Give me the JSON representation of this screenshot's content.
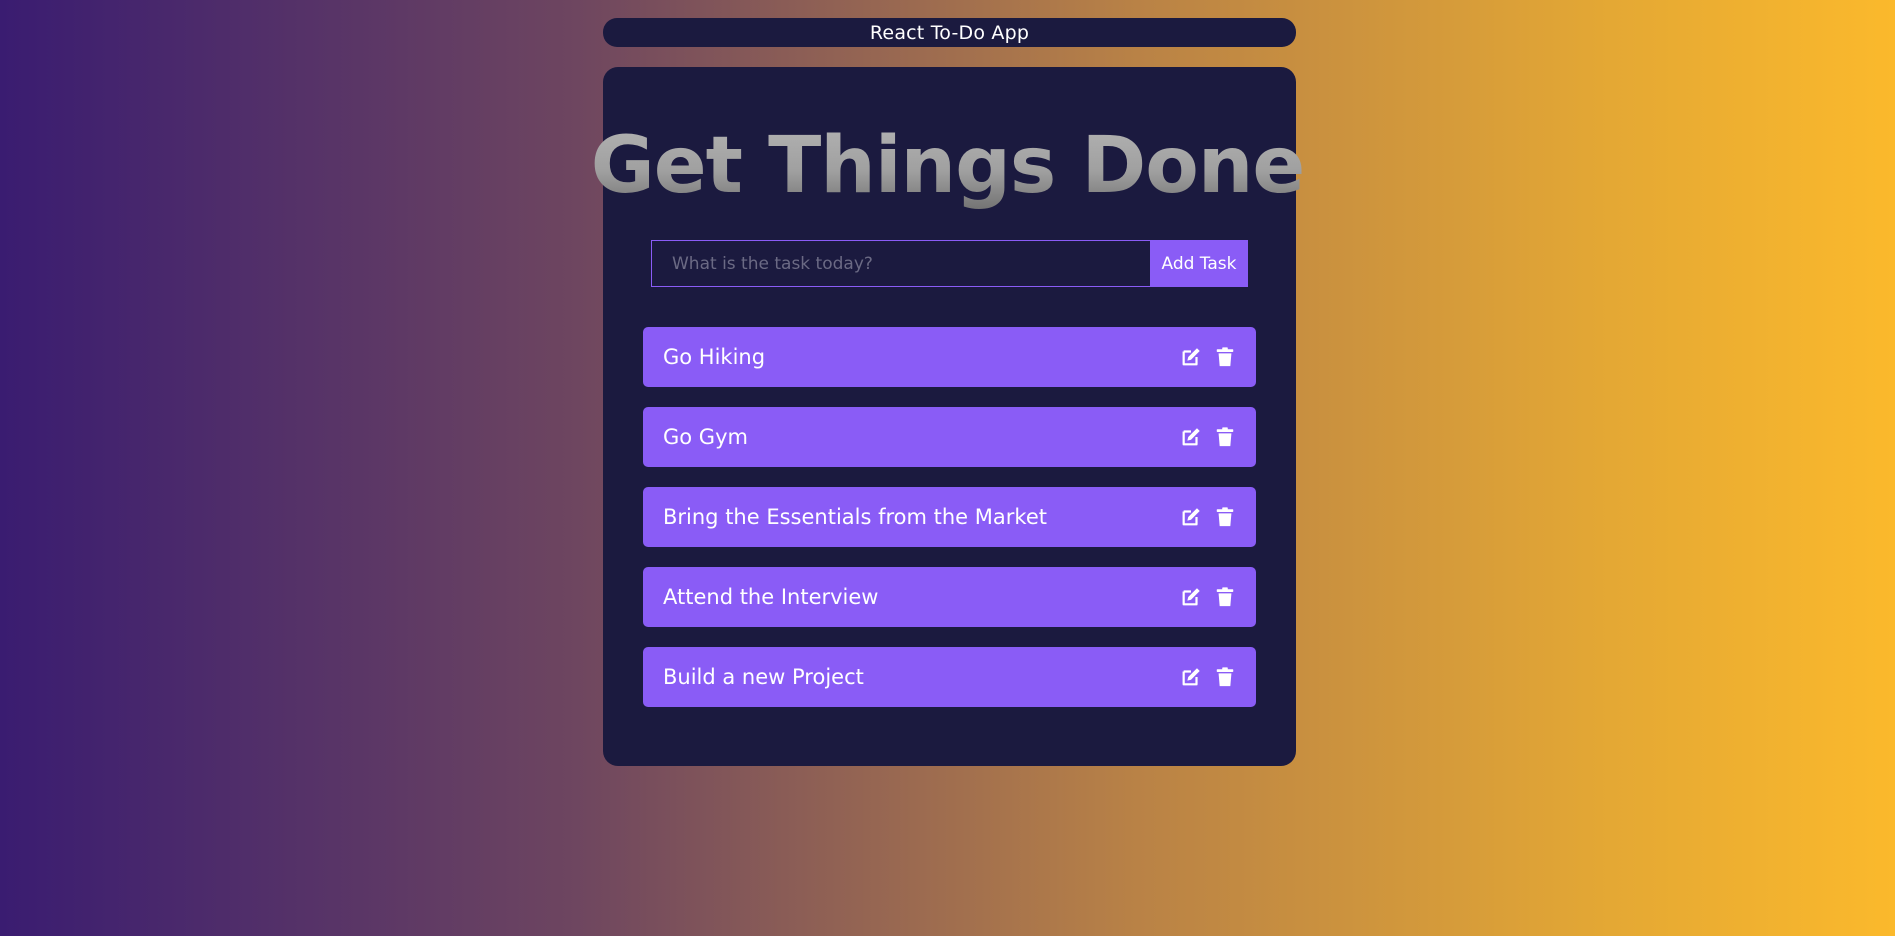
{
  "header": {
    "title": "React To-Do App"
  },
  "main": {
    "headline": "Get Things Done",
    "form": {
      "input_value": "",
      "input_placeholder": "What is the task today?",
      "add_button_label": "Add Task"
    },
    "tasks": [
      {
        "text": "Go Hiking"
      },
      {
        "text": "Go Gym"
      },
      {
        "text": "Bring the Essentials from the Market"
      },
      {
        "text": "Attend the Interview"
      },
      {
        "text": "Build a new Project"
      }
    ],
    "task_icons": [
      "edit-icon",
      "trash-icon"
    ]
  },
  "colors": {
    "card_background": "#1b1a3f",
    "accent": "#8a5cf6",
    "text": "#ffffff",
    "gradient_start": "#3a1c71",
    "gradient_end": "#fbb92c"
  }
}
